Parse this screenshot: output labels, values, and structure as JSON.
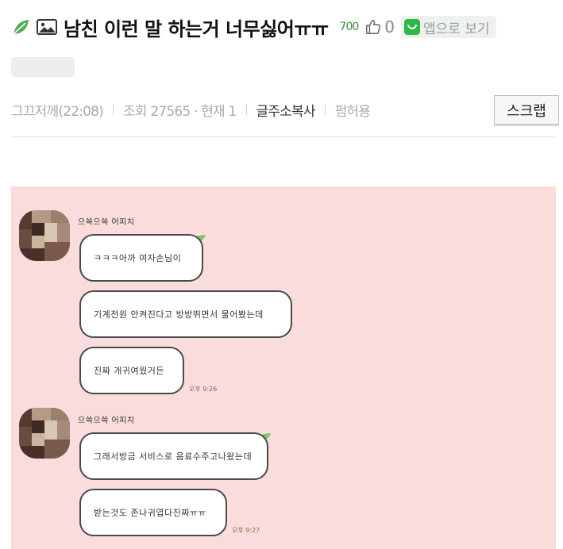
{
  "post": {
    "title": "남친 이런 말 하는거 너무싫어ㅠㅠ",
    "views": "700",
    "likes": "0",
    "app_button_label": "앱으로 보기"
  },
  "meta": {
    "date": "그끄저께(22:08)",
    "views": "조회 27565 · 현재 1",
    "copy_link": "글주소복사",
    "permission": "펌허용",
    "scrap_label": "스크랩"
  },
  "chat": {
    "groups": [
      {
        "sender": "으쓱으쓱 어피치",
        "messages": [
          "ㅋㅋㅋ아까 여자손님이",
          "기계전원 안켜진다고 방방뛰면서 물어봤는데",
          "진짜 개귀여웠거든"
        ],
        "time": "오후 9:26"
      },
      {
        "sender": "으쓱으쓱 어피치",
        "messages": [
          "그래서방금 서비스로 음료수주고나왔는데",
          "받는것도 존나귀엽다진짜ㅠㅠ"
        ],
        "time": "오후 9:27"
      }
    ]
  },
  "colors": {
    "chat_background": "#fbdcdc",
    "accent_green": "#2db84b",
    "view_count_green": "#3a8f3a"
  },
  "icons": {
    "leaf": "leaf-icon",
    "image": "image-icon",
    "like": "thumbs-up-icon",
    "app": "app-icon"
  }
}
